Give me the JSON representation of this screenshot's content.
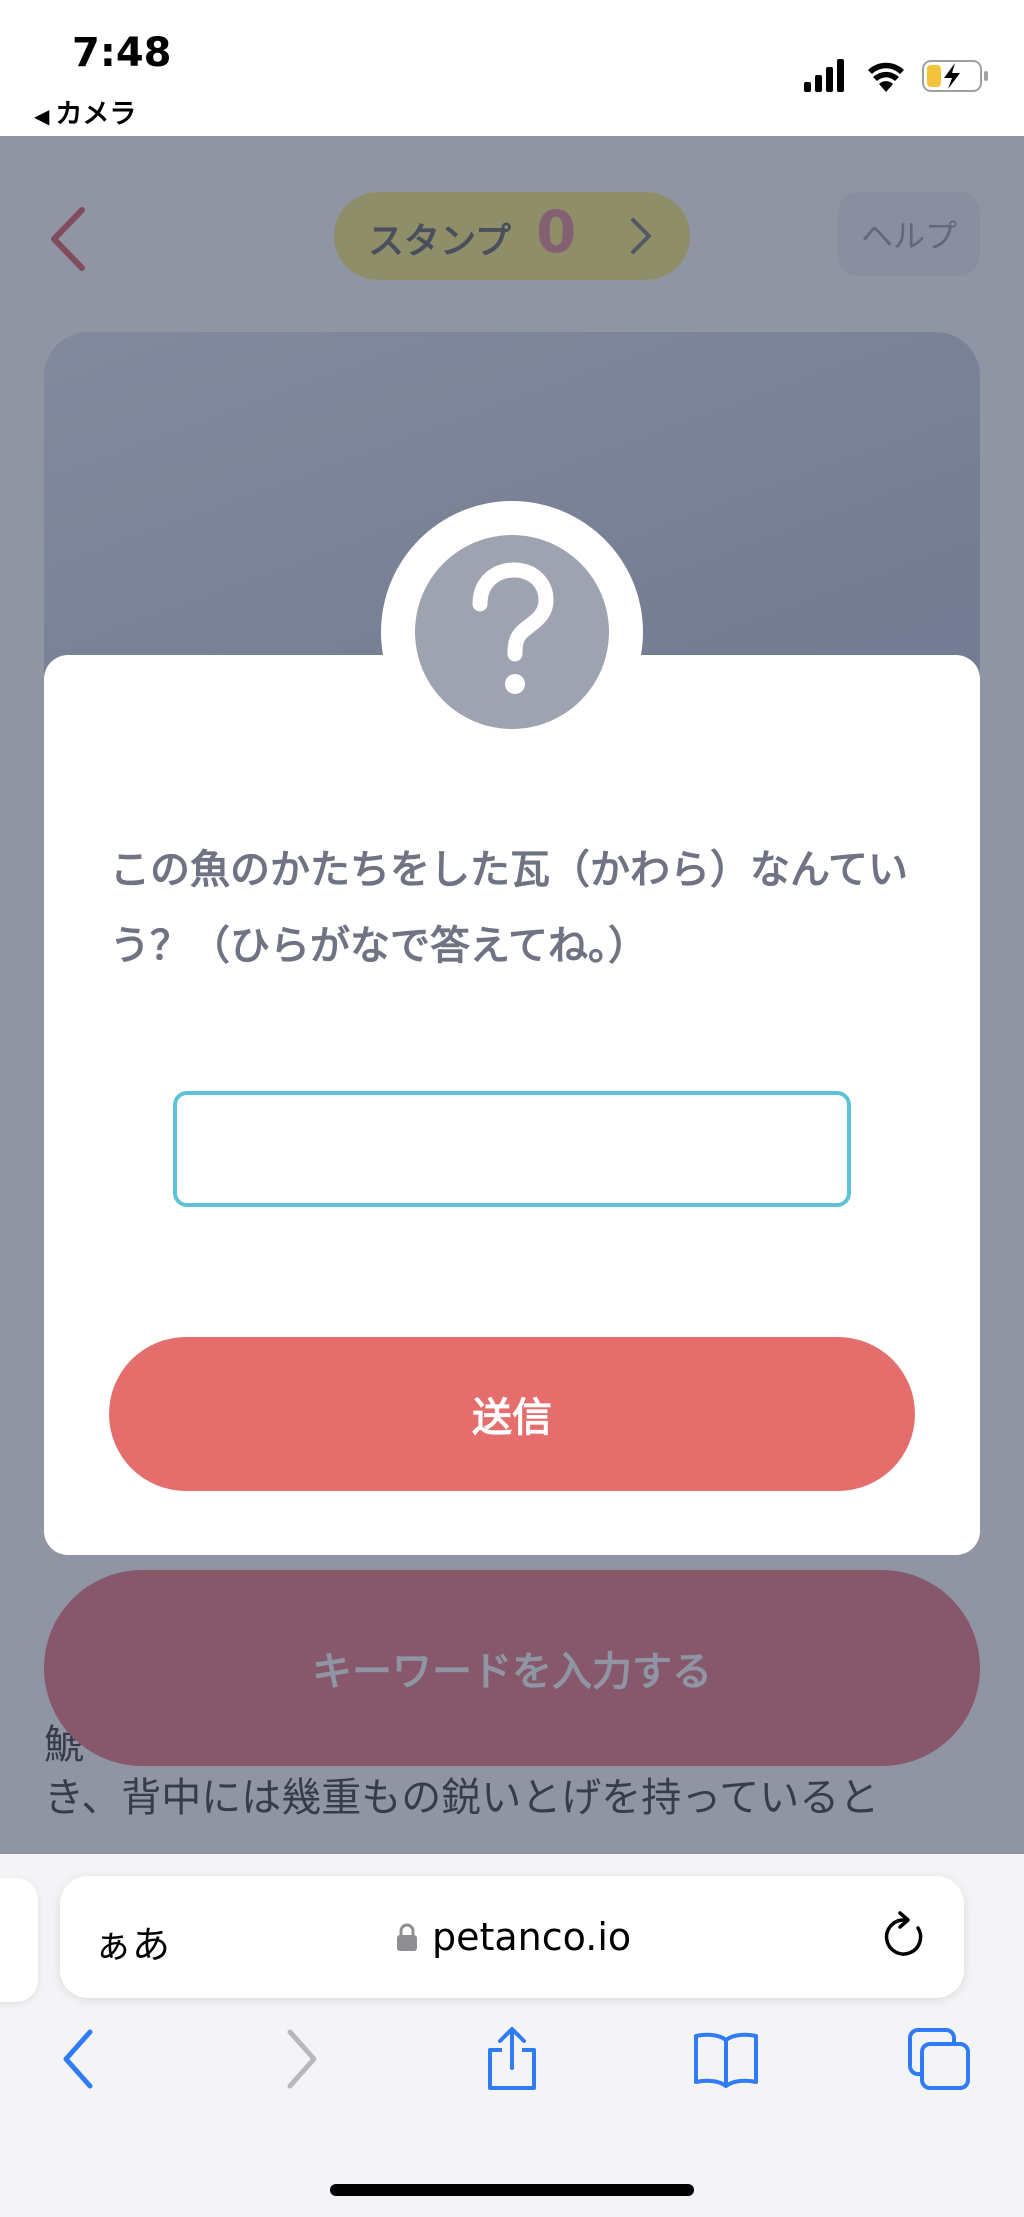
{
  "status_bar": {
    "time": "7:48",
    "back_label": "カメラ"
  },
  "header": {
    "stamp_label": "スタンプ",
    "stamp_count": "0",
    "help_label": "ヘルプ"
  },
  "page": {
    "keyword_button_label": "キーワードを入力する",
    "body_fragment": "鯱",
    "body_text": "き、背中には幾重もの鋭いとげを持っていると"
  },
  "modal": {
    "question": "この魚のかたちをした瓦（かわら）なんていう？（ひらがなで答えてね。）",
    "answer_value": "",
    "answer_placeholder": "",
    "submit_label": "送信"
  },
  "browser": {
    "text_size_label": "ぁあ",
    "url": "petanco.io"
  },
  "colors": {
    "accent_red": "#e56d6c",
    "input_border": "#5ec3d9",
    "stamp_yellow": "#fbf28d"
  }
}
